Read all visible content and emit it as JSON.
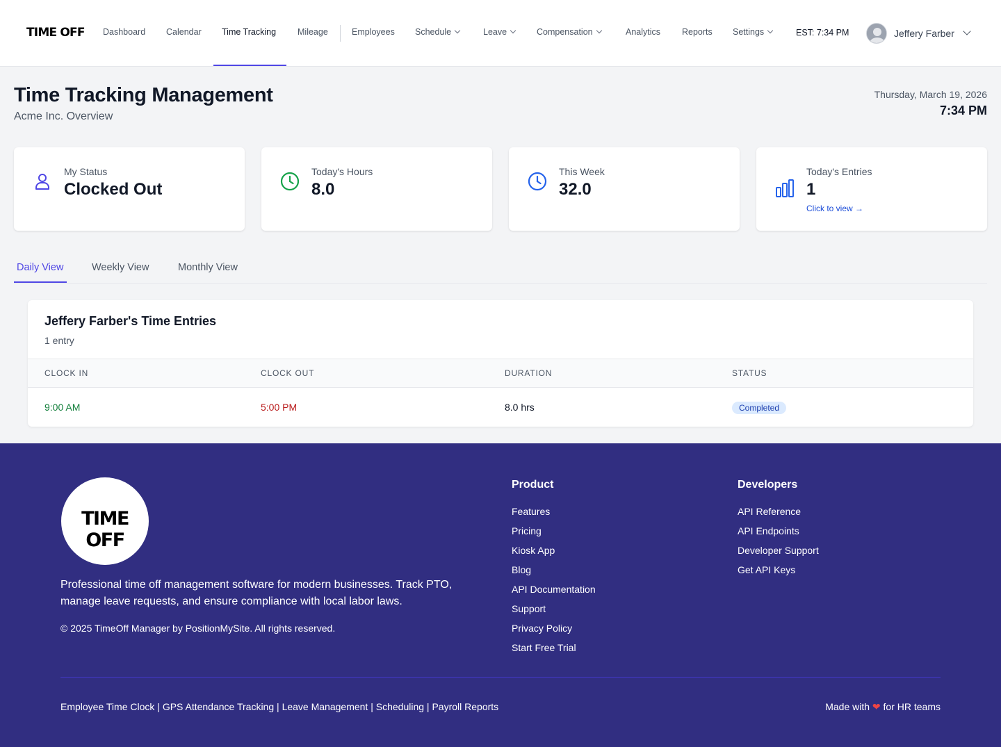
{
  "app": {
    "logo": "TIME OFF"
  },
  "nav": {
    "items": [
      {
        "label": "Dashboard"
      },
      {
        "label": "Calendar"
      },
      {
        "label": "Time Tracking"
      },
      {
        "label": "Mileage"
      },
      {
        "label": "Employees"
      },
      {
        "label": "Schedule"
      },
      {
        "label": "Leave"
      },
      {
        "label": "Compensation"
      },
      {
        "label": "Analytics"
      },
      {
        "label": "Reports"
      },
      {
        "label": "Settings"
      }
    ],
    "active": "Time Tracking",
    "clock": "EST: 7:34 PM",
    "user_name": "Jeffery Farber"
  },
  "page": {
    "title": "Time Tracking Management",
    "subtitle": "Acme Inc. Overview",
    "date": "Thursday, March 19, 2026",
    "time": "7:34 PM"
  },
  "stats": [
    {
      "label": "My Status",
      "value": "Clocked Out",
      "icon": "user-icon"
    },
    {
      "label": "Today's Hours",
      "value": "8.0",
      "icon": "clock-icon"
    },
    {
      "label": "This Week",
      "value": "32.0",
      "icon": "clock-icon"
    },
    {
      "label": "Today's Entries",
      "value": "1",
      "icon": "bar-chart-icon",
      "link": "Click to view →"
    }
  ],
  "tabs": [
    {
      "label": "Daily View"
    },
    {
      "label": "Weekly View"
    },
    {
      "label": "Monthly View"
    }
  ],
  "entries": {
    "title": "Jeffery Farber's Time Entries",
    "count": "1 entry",
    "columns": [
      "CLOCK IN",
      "CLOCK OUT",
      "DURATION",
      "STATUS"
    ],
    "rows": [
      {
        "clock_in": "9:00 AM",
        "clock_out": "5:00 PM",
        "duration": "8.0 hrs",
        "status": "Completed"
      }
    ]
  },
  "footer": {
    "logo": "TIME OFF",
    "description": "Professional time off management software for modern businesses. Track PTO, manage leave requests, and ensure compliance with local labor laws.",
    "copyright": "© 2025 TimeOff Manager by PositionMySite. All rights reserved.",
    "product_title": "Product",
    "product_links": [
      "Features",
      "Pricing",
      "Kiosk App",
      "Blog",
      "API Documentation",
      "Support",
      "Privacy Policy",
      "Start Free Trial"
    ],
    "developers_title": "Developers",
    "developer_links": [
      "API Reference",
      "API Endpoints",
      "Developer Support",
      "Get API Keys"
    ],
    "bottom_links": [
      "Employee Time Clock",
      "GPS Attendance Tracking",
      "Leave Management",
      "Scheduling",
      "Payroll Reports"
    ],
    "made_with_prefix": "Made with",
    "made_with_suffix": "for HR teams"
  },
  "colors": {
    "accent": "#4f46e5",
    "footer_bg": "#312e81",
    "clock_in": "#15803d",
    "clock_out": "#b91c1c",
    "badge_bg": "#dbeafe"
  }
}
